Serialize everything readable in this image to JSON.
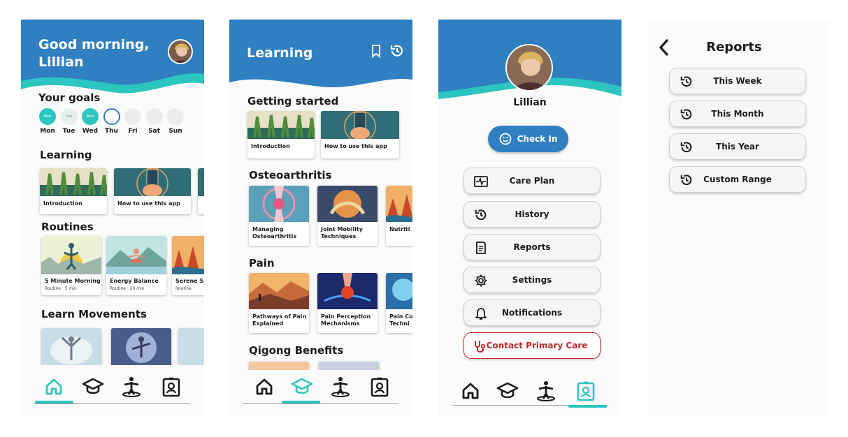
{
  "colors": {
    "primary": "#2f7fc1",
    "accent": "#2dc5c0",
    "danger": "#c62828"
  },
  "home": {
    "greeting": "Good morning, Lillian",
    "goals_title": "Your goals",
    "days": [
      {
        "label": "Mon",
        "state": "done",
        "mark": "Mon"
      },
      {
        "label": "Tue",
        "state": "partial",
        "mark": "Tue"
      },
      {
        "label": "Wed",
        "state": "done",
        "mark": "Wed"
      },
      {
        "label": "Thu",
        "state": "today",
        "mark": ""
      },
      {
        "label": "Fri",
        "state": "empty",
        "mark": ""
      },
      {
        "label": "Sat",
        "state": "empty",
        "mark": ""
      },
      {
        "label": "Sun",
        "state": "empty",
        "mark": ""
      }
    ],
    "learning_title": "Learning",
    "learning_cards": [
      "Introduction",
      "How to use this app"
    ],
    "routines_title": "Routines",
    "routine_cards": [
      {
        "title": "5 Minute Morning",
        "meta": "Routine · 5 min"
      },
      {
        "title": "Energy Balance",
        "meta": "Routine · 20 min"
      },
      {
        "title": "Serene S",
        "meta": "Routine"
      }
    ],
    "movements_title": "Learn Movements"
  },
  "learning": {
    "title": "Learning",
    "sections": [
      {
        "title": "Getting started",
        "cards": [
          "Introduction",
          "How to use this app"
        ]
      },
      {
        "title": "Osteoarthritis",
        "cards": [
          "Managing Osteoarthritis",
          "Joint Mobility Techniques",
          "Nutriti"
        ]
      },
      {
        "title": "Pain",
        "cards": [
          "Pathways of Pain Explained",
          "Pain Perception Mechanisms",
          "Pain Co Techni"
        ]
      },
      {
        "title": "Qigong Benefits",
        "cards": []
      }
    ]
  },
  "profile": {
    "name": "Lillian",
    "checkin": "Check In",
    "menu": [
      {
        "label": "Care Plan",
        "icon": "care-plan-icon"
      },
      {
        "label": "History",
        "icon": "history-icon"
      },
      {
        "label": "Reports",
        "icon": "reports-icon"
      },
      {
        "label": "Settings",
        "icon": "gear-icon"
      },
      {
        "label": "Notifications",
        "icon": "bell-icon"
      }
    ],
    "contact": "Contact Primary Care"
  },
  "reports": {
    "title": "Reports",
    "options": [
      "This Week",
      "This Month",
      "This Year",
      "Custom Range"
    ]
  }
}
